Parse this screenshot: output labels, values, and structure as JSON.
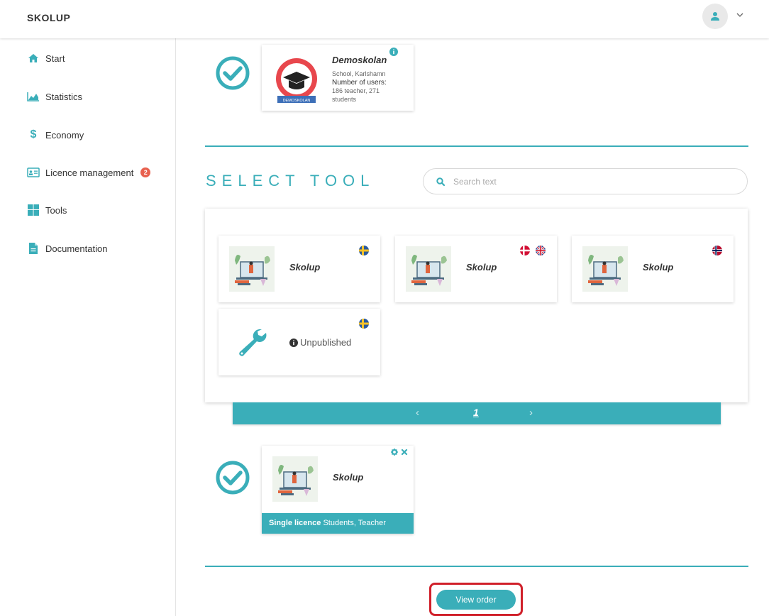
{
  "app": {
    "brand": "SKOLUP"
  },
  "user_menu": {
    "avatar_icon": "user-icon",
    "chevron_icon": "chevron-down-icon"
  },
  "sidebar": {
    "items": [
      {
        "label": "Start",
        "icon": "home-icon"
      },
      {
        "label": "Statistics",
        "icon": "area-chart-icon"
      },
      {
        "label": "Economy",
        "icon": "dollar-icon"
      },
      {
        "label": "Licence management",
        "icon": "id-card-icon",
        "badge": "2"
      },
      {
        "label": "Tools",
        "icon": "grid-icon"
      },
      {
        "label": "Documentation",
        "icon": "document-icon"
      }
    ]
  },
  "school": {
    "name": "Demoskolan",
    "type": "School, Karlshamn",
    "users_label": "Number of users:",
    "users_line1": "186 teacher, 271",
    "users_line2": "students",
    "logo_text": "DEMOSKOLAN"
  },
  "select_tool": {
    "title": "SELECT TOOL",
    "search_placeholder": "Search text"
  },
  "tools": [
    {
      "name": "Skolup",
      "flags": [
        "se"
      ]
    },
    {
      "name": "Skolup",
      "flags": [
        "dk",
        "gb"
      ]
    },
    {
      "name": "Skolup",
      "flags": [
        "no"
      ]
    },
    {
      "name": "",
      "status": "Unpublished",
      "flags": [
        "se"
      ]
    }
  ],
  "pager": {
    "prev": "‹",
    "current": "1",
    "next": "›"
  },
  "selected_tool": {
    "name": "Skolup",
    "licence_type": "Single licence",
    "licence_for": "Students, Teacher"
  },
  "actions": {
    "view_order": "View order"
  },
  "colors": {
    "accent": "#3aaeb9",
    "badge": "#e8614f",
    "highlight": "#d0202a"
  }
}
